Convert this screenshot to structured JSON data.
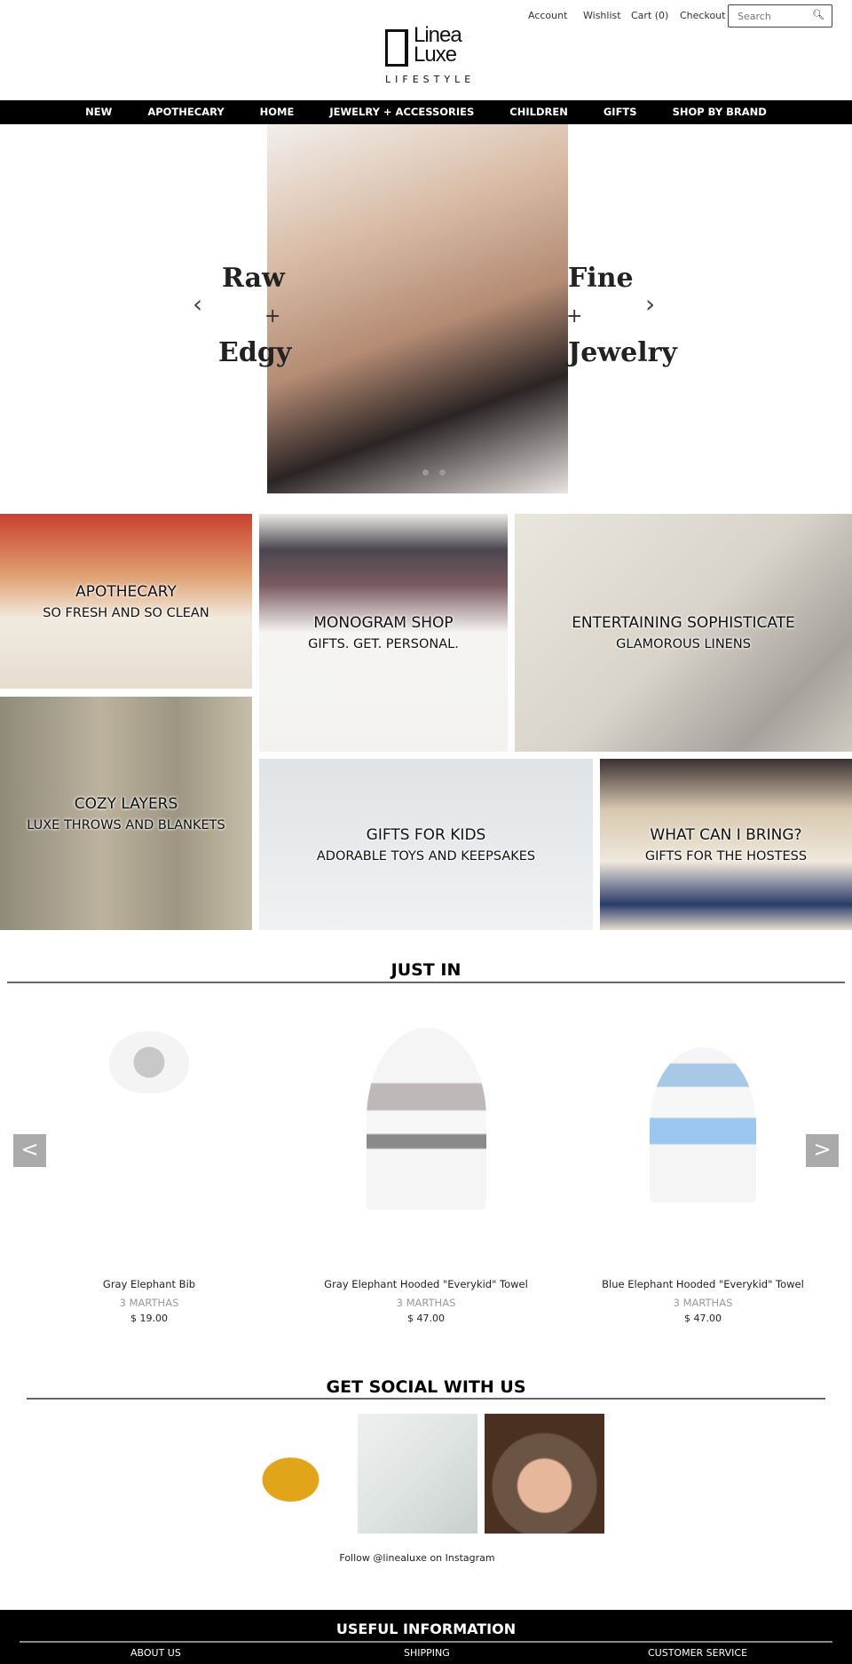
{
  "header": {
    "links": [
      "Account",
      "Wishlist",
      "Cart (0)",
      "Checkout"
    ],
    "search_placeholder": "Search",
    "search_icon": "magnifier-icon",
    "logo": {
      "line1": "Linea",
      "line2": "Luxe",
      "line3": "LIFESTYLE"
    }
  },
  "nav": [
    "NEW",
    "APOTHECARY",
    "HOME",
    "JEWELRY + ACCESSORIES",
    "CHILDREN",
    "GIFTS",
    "SHOP BY BRAND"
  ],
  "hero": {
    "left": {
      "top": "Raw",
      "plus": "+",
      "bottom": "Edgy"
    },
    "right": {
      "top": "Fine",
      "plus": "+",
      "bottom": "Jewelry"
    },
    "prev": "‹",
    "next": "›",
    "slides": 3,
    "active_slide": 1
  },
  "tiles": [
    {
      "title": "APOTHECARY",
      "subtitle": "SO FRESH AND SO CLEAN"
    },
    {
      "title": "MONOGRAM SHOP",
      "subtitle": "GIFTS. GET. PERSONAL."
    },
    {
      "title": "ENTERTAINING SOPHISTICATE",
      "subtitle": "GLAMOROUS LINENS"
    },
    {
      "title": "COZY LAYERS",
      "subtitle": "LUXE THROWS AND BLANKETS"
    },
    {
      "title": "GIFTS FOR KIDS",
      "subtitle": "ADORABLE TOYS AND KEEPSAKES"
    },
    {
      "title": "WHAT CAN I BRING?",
      "subtitle": "GIFTS FOR THE HOSTESS"
    }
  ],
  "just_in": {
    "heading": "JUST IN",
    "prev": "<",
    "next": ">",
    "products": [
      {
        "name": "Gray Elephant Bib",
        "brand": "3 MARTHAS",
        "price": "$ 19.00"
      },
      {
        "name": "Gray Elephant Hooded \"Everykid\" Towel",
        "brand": "3 MARTHAS",
        "price": "$ 47.00"
      },
      {
        "name": "Blue Elephant Hooded \"Everykid\" Towel",
        "brand": "3 MARTHAS",
        "price": "$ 47.00"
      }
    ]
  },
  "social": {
    "heading": "GET SOCIAL WITH US",
    "follow": "Follow @linealuxe on Instagram"
  },
  "footer": {
    "heading": "USEFUL INFORMATION",
    "links": [
      "ABOUT US",
      "SHIPPING",
      "CUSTOMER SERVICE"
    ]
  }
}
